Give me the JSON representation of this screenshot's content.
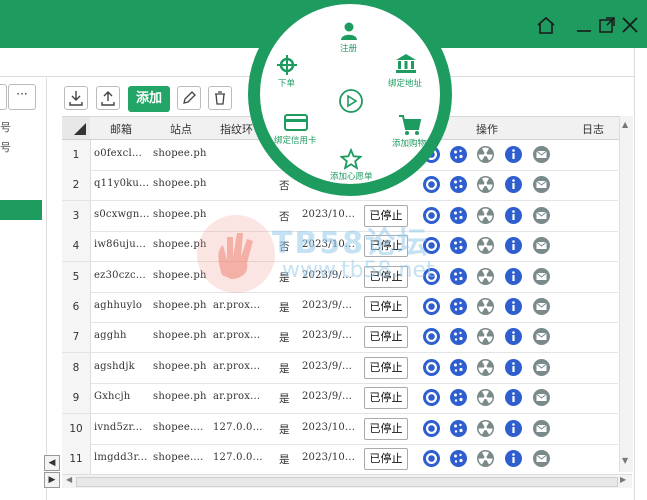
{
  "window": {
    "controls": [
      "home-icon",
      "minimize-icon",
      "restore-icon",
      "close-icon"
    ]
  },
  "left_panel": {
    "texts": [
      "号",
      "号"
    ],
    "more_label": "···",
    "scroll_left": "◀",
    "scroll_right": "▶"
  },
  "toolbar": {
    "add_label": "添加",
    "icons": [
      "import-icon",
      "export-icon",
      "edit-icon",
      "delete-icon"
    ]
  },
  "table": {
    "headers": {
      "email": "邮箱",
      "site": "站点",
      "proxy": "指纹环",
      "actions": "操作",
      "log": "日志"
    },
    "rows": [
      {
        "num": "1",
        "email": "o0fexcl...",
        "site": "shopee.ph",
        "proxy": "",
        "flag": "",
        "date": "",
        "status": ""
      },
      {
        "num": "2",
        "email": "q11y0ku...",
        "site": "shopee.ph",
        "proxy": "",
        "flag": "否",
        "date": "",
        "status": ""
      },
      {
        "num": "3",
        "email": "s0cxwgn...",
        "site": "shopee.ph",
        "proxy": "",
        "flag": "否",
        "date": "2023/10...",
        "status": "已停止"
      },
      {
        "num": "4",
        "email": "iw86uju...",
        "site": "shopee.ph",
        "proxy": "",
        "flag": "否",
        "date": "2023/10...",
        "status": "已停止"
      },
      {
        "num": "5",
        "email": "ez30czc...",
        "site": "shopee.ph",
        "proxy": "",
        "flag": "是",
        "date": "2023/9/...",
        "status": "已停止"
      },
      {
        "num": "6",
        "email": "aghhuylo",
        "site": "shopee.ph",
        "proxy": "ar.prox...",
        "flag": "是",
        "date": "2023/9/...",
        "status": "已停止"
      },
      {
        "num": "7",
        "email": "agghh",
        "site": "shopee.ph",
        "proxy": "ar.prox...",
        "flag": "是",
        "date": "2023/9/...",
        "status": "已停止"
      },
      {
        "num": "8",
        "email": "agshdjk",
        "site": "shopee.ph",
        "proxy": "ar.prox...",
        "flag": "是",
        "date": "2023/9/...",
        "status": "已停止"
      },
      {
        "num": "9",
        "email": "Gxhcjh",
        "site": "shopee.ph",
        "proxy": "ar.prox...",
        "flag": "是",
        "date": "2023/9/...",
        "status": "已停止"
      },
      {
        "num": "10",
        "email": "ivnd5zr...",
        "site": "shopee....",
        "proxy": "127.0.0...",
        "flag": "是",
        "date": "2023/10...",
        "status": "已停止"
      },
      {
        "num": "11",
        "email": "lmgdd3r...",
        "site": "shopee....",
        "proxy": "127.0.0...",
        "flag": "是",
        "date": "2023/10...",
        "status": "已停止"
      }
    ],
    "action_icons": [
      "chrome-icon",
      "cookie-icon",
      "nuclear-icon",
      "info-icon",
      "mail-icon"
    ]
  },
  "radial_menu": {
    "items": {
      "top": "注册",
      "top_left": "下单",
      "top_right": "绑定地址",
      "left": "绑定信用卡",
      "right": "添加购物车",
      "bottom": "添加心愿单"
    },
    "center_icon": "play-icon"
  },
  "watermark": {
    "title": "TB58论坛",
    "url": "www.tb58.net"
  },
  "colors": {
    "brand_green": "#1e9b5f",
    "action_blue": "#2f5fcf",
    "action_gray": "#7a8a8a"
  }
}
